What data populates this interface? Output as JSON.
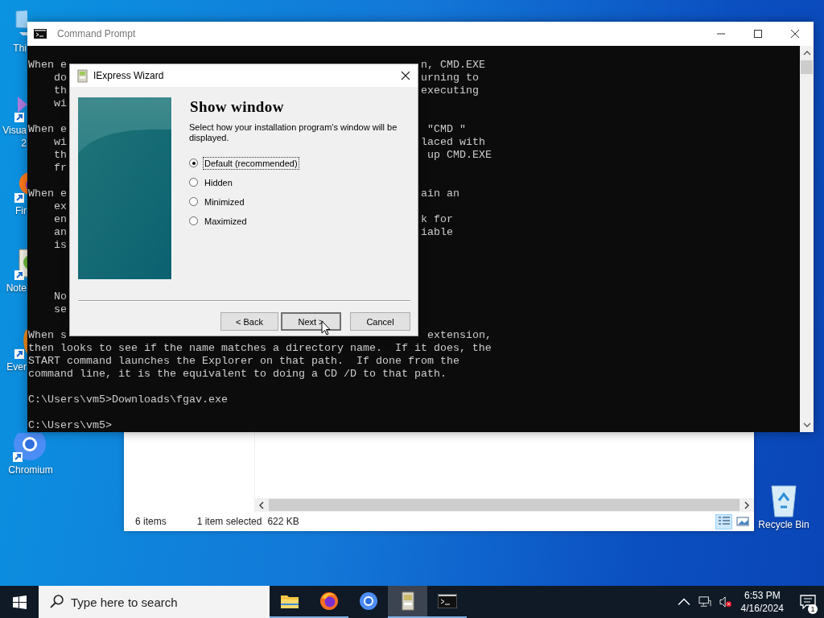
{
  "desktop_icons": [
    {
      "kind": "pc",
      "label": "Thi"
    },
    {
      "kind": "vs",
      "label": "Visua",
      "label_line_2": "2"
    },
    {
      "kind": "firefox",
      "label": "Fir"
    },
    {
      "kind": "notepad",
      "label": "Note"
    },
    {
      "kind": "evernote",
      "label": "Ever"
    },
    {
      "kind": "chromium",
      "label": "Chromium"
    },
    {
      "kind": "recycle",
      "label": "Recycle Bin"
    }
  ],
  "explorer": {
    "status": [
      "6 items",
      "1 item selected",
      "622 KB"
    ],
    "views": [
      {
        "kind": "details",
        "selected": true
      },
      {
        "kind": "large",
        "selected": false
      }
    ]
  },
  "console": {
    "title": "Command Prompt",
    "lines": [
      {
        "kind": "text",
        "left": "When e",
        "right": "n, CMD.EXE"
      },
      {
        "kind": "text",
        "left": "    do",
        "right": "urning to"
      },
      {
        "kind": "text",
        "left": "    th",
        "right": "executing"
      },
      {
        "kind": "text",
        "left": "    wi"
      },
      {
        "kind": "blank"
      },
      {
        "kind": "text",
        "left": "When e",
        "right": " \"CMD \""
      },
      {
        "kind": "text",
        "left": "    wi",
        "right": "laced with"
      },
      {
        "kind": "text",
        "left": "    th",
        "right": " up CMD.EXE"
      },
      {
        "kind": "text",
        "left": "    fr"
      },
      {
        "kind": "blank"
      },
      {
        "kind": "text",
        "left": "When e",
        "right": "ain an"
      },
      {
        "kind": "text",
        "left": "    ex"
      },
      {
        "kind": "text",
        "left": "    en",
        "right": "k for"
      },
      {
        "kind": "text",
        "left": "    an",
        "right": "iable"
      },
      {
        "kind": "text",
        "left": "    is"
      },
      {
        "kind": "blank"
      },
      {
        "kind": "blank"
      },
      {
        "kind": "blank"
      },
      {
        "kind": "text",
        "left": "    No"
      },
      {
        "kind": "text",
        "left": "    se"
      },
      {
        "kind": "blank"
      },
      {
        "kind": "text",
        "left": "When s",
        "right": " extension,"
      },
      {
        "kind": "text",
        "left": "then looks to see if the name matches a directory name.  If it does, the"
      },
      {
        "kind": "text",
        "left": "START command launches the Explorer on that path.  If done from the"
      },
      {
        "kind": "text",
        "left": "command line, it is the equivalent to doing a CD /D to that path."
      },
      {
        "kind": "blank"
      },
      {
        "kind": "text",
        "left": "C:\\Users\\vm5>Downloads\\fgav.exe"
      },
      {
        "kind": "blank"
      },
      {
        "kind": "text",
        "left": "C:\\Users\\vm5>"
      }
    ]
  },
  "wizard": {
    "title": "IExpress Wizard",
    "heading": "Show window",
    "description": "Select how your installation program's window will be displayed.",
    "options": [
      {
        "label": "Default (recommended)",
        "selected": true
      },
      {
        "label": "Hidden",
        "selected": false
      },
      {
        "label": "Minimized",
        "selected": false
      },
      {
        "label": "Maximized",
        "selected": false
      }
    ],
    "buttons": [
      {
        "label": "< Back",
        "default": false
      },
      {
        "label": "Next >",
        "default": true
      },
      {
        "label": "Cancel",
        "default": false
      }
    ]
  },
  "taskbar": {
    "search": {
      "placeholder": "Type here to search"
    },
    "apps": [
      {
        "kind": "explorer",
        "running": true,
        "active": false
      },
      {
        "kind": "firefox",
        "running": true,
        "active": false
      },
      {
        "kind": "chromium",
        "running": false,
        "active": false
      },
      {
        "kind": "iexpress",
        "running": true,
        "active": true
      },
      {
        "kind": "cmd",
        "running": true,
        "active": false
      }
    ],
    "time": "6:53 PM",
    "date": "4/16/2024",
    "notifications": "1"
  }
}
